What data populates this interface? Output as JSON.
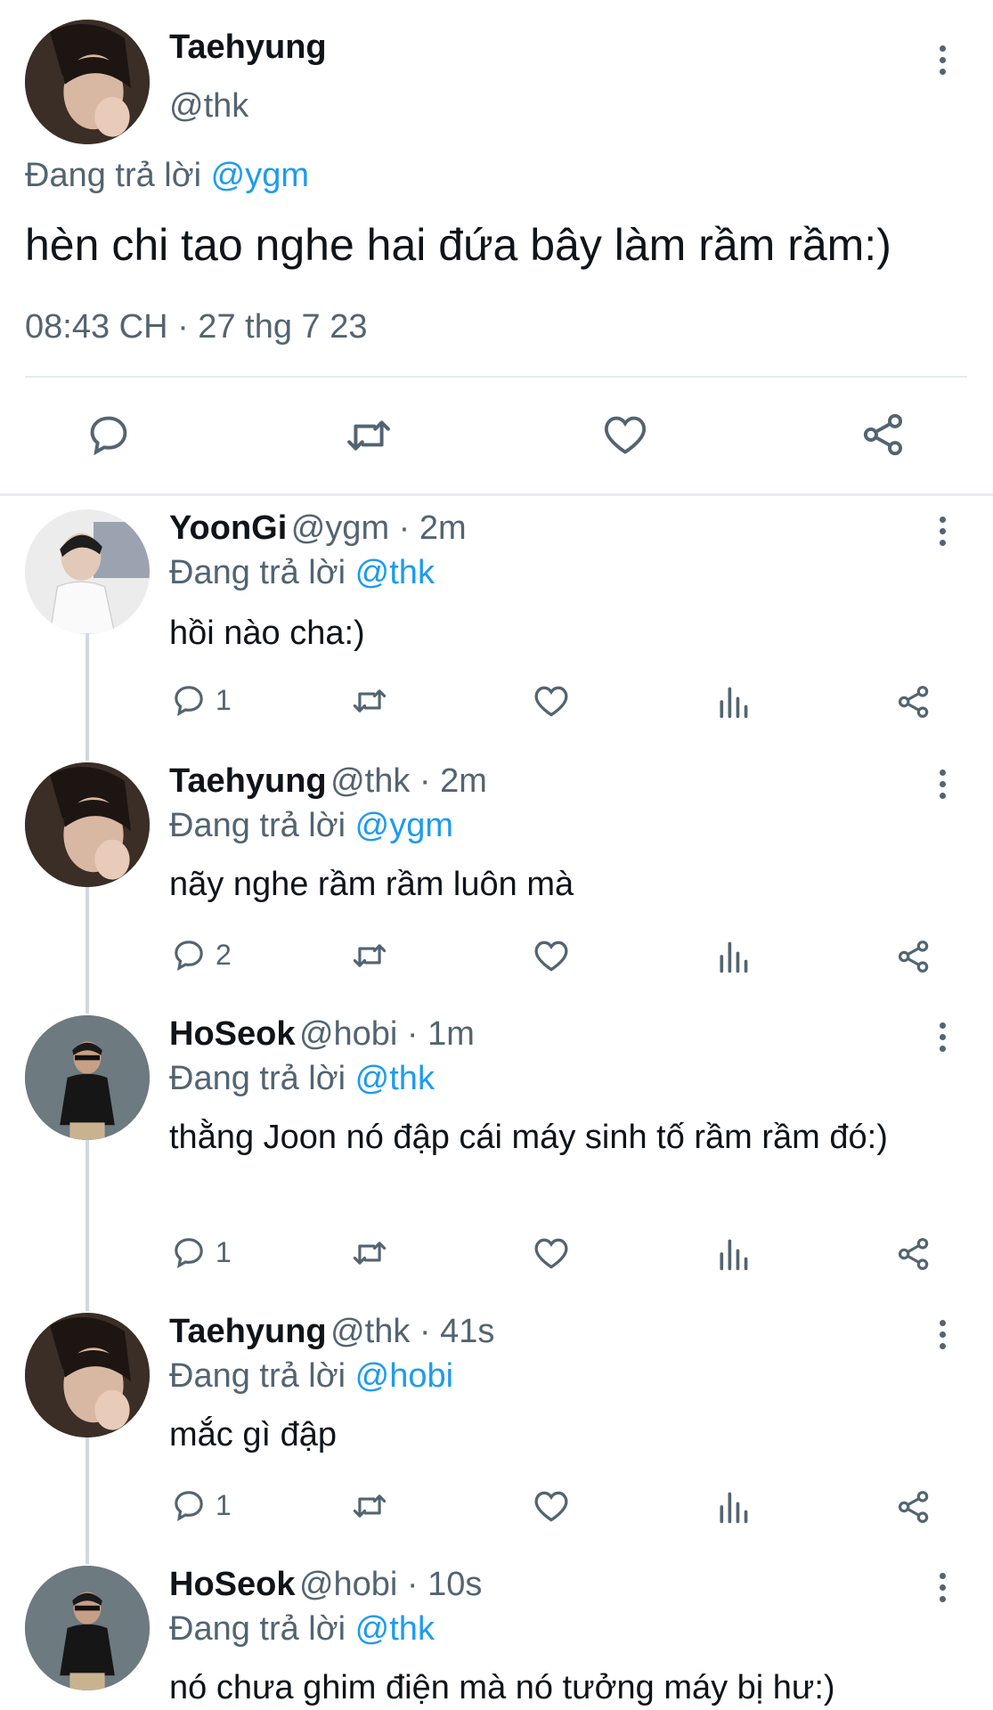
{
  "main_tweet": {
    "name": "Taehyung",
    "handle": "@thk",
    "reply_prefix": "Đang trả lời",
    "reply_to": "@ygm",
    "text": "hèn chi tao nghe hai đứa bây làm rầm rầm:)",
    "timestamp": "08:43 CH · 27 thg 7 23"
  },
  "replies": [
    {
      "name": "YoonGi",
      "meta": "@ygm · 2m",
      "reply_prefix": "Đang trả lời",
      "reply_to": "@thk",
      "text": "hồi nào cha:)",
      "reply_count": "1"
    },
    {
      "name": "Taehyung",
      "meta": "@thk · 2m",
      "reply_prefix": "Đang trả lời",
      "reply_to": "@ygm",
      "text": "nãy nghe rầm rầm luôn mà",
      "reply_count": "2"
    },
    {
      "name": "HoSeok",
      "meta": "@hobi · 1m",
      "reply_prefix": "Đang trả lời",
      "reply_to": "@thk",
      "text": "thằng Joon nó đập cái máy sinh tố rầm rầm đó:)",
      "reply_count": "1"
    },
    {
      "name": "Taehyung",
      "meta": "@thk · 41s",
      "reply_prefix": "Đang trả lời",
      "reply_to": "@hobi",
      "text": "mắc gì đập",
      "reply_count": "1"
    },
    {
      "name": "HoSeok",
      "meta": "@hobi · 10s",
      "reply_prefix": "Đang trả lời",
      "reply_to": "@thk",
      "text": "nó chưa ghim điện mà nó tưởng máy bị hư:)",
      "reply_count": ""
    }
  ],
  "icons": {
    "reply": "comment-bubble-icon",
    "retweet": "retweet-icon",
    "like": "heart-icon",
    "views": "bar-chart-icon",
    "share": "share-icon",
    "more": "kebab-menu-icon"
  },
  "colors": {
    "text": "#0f1419",
    "muted": "#536471",
    "link": "#1d9bf0",
    "divider": "#e6ecf0"
  }
}
